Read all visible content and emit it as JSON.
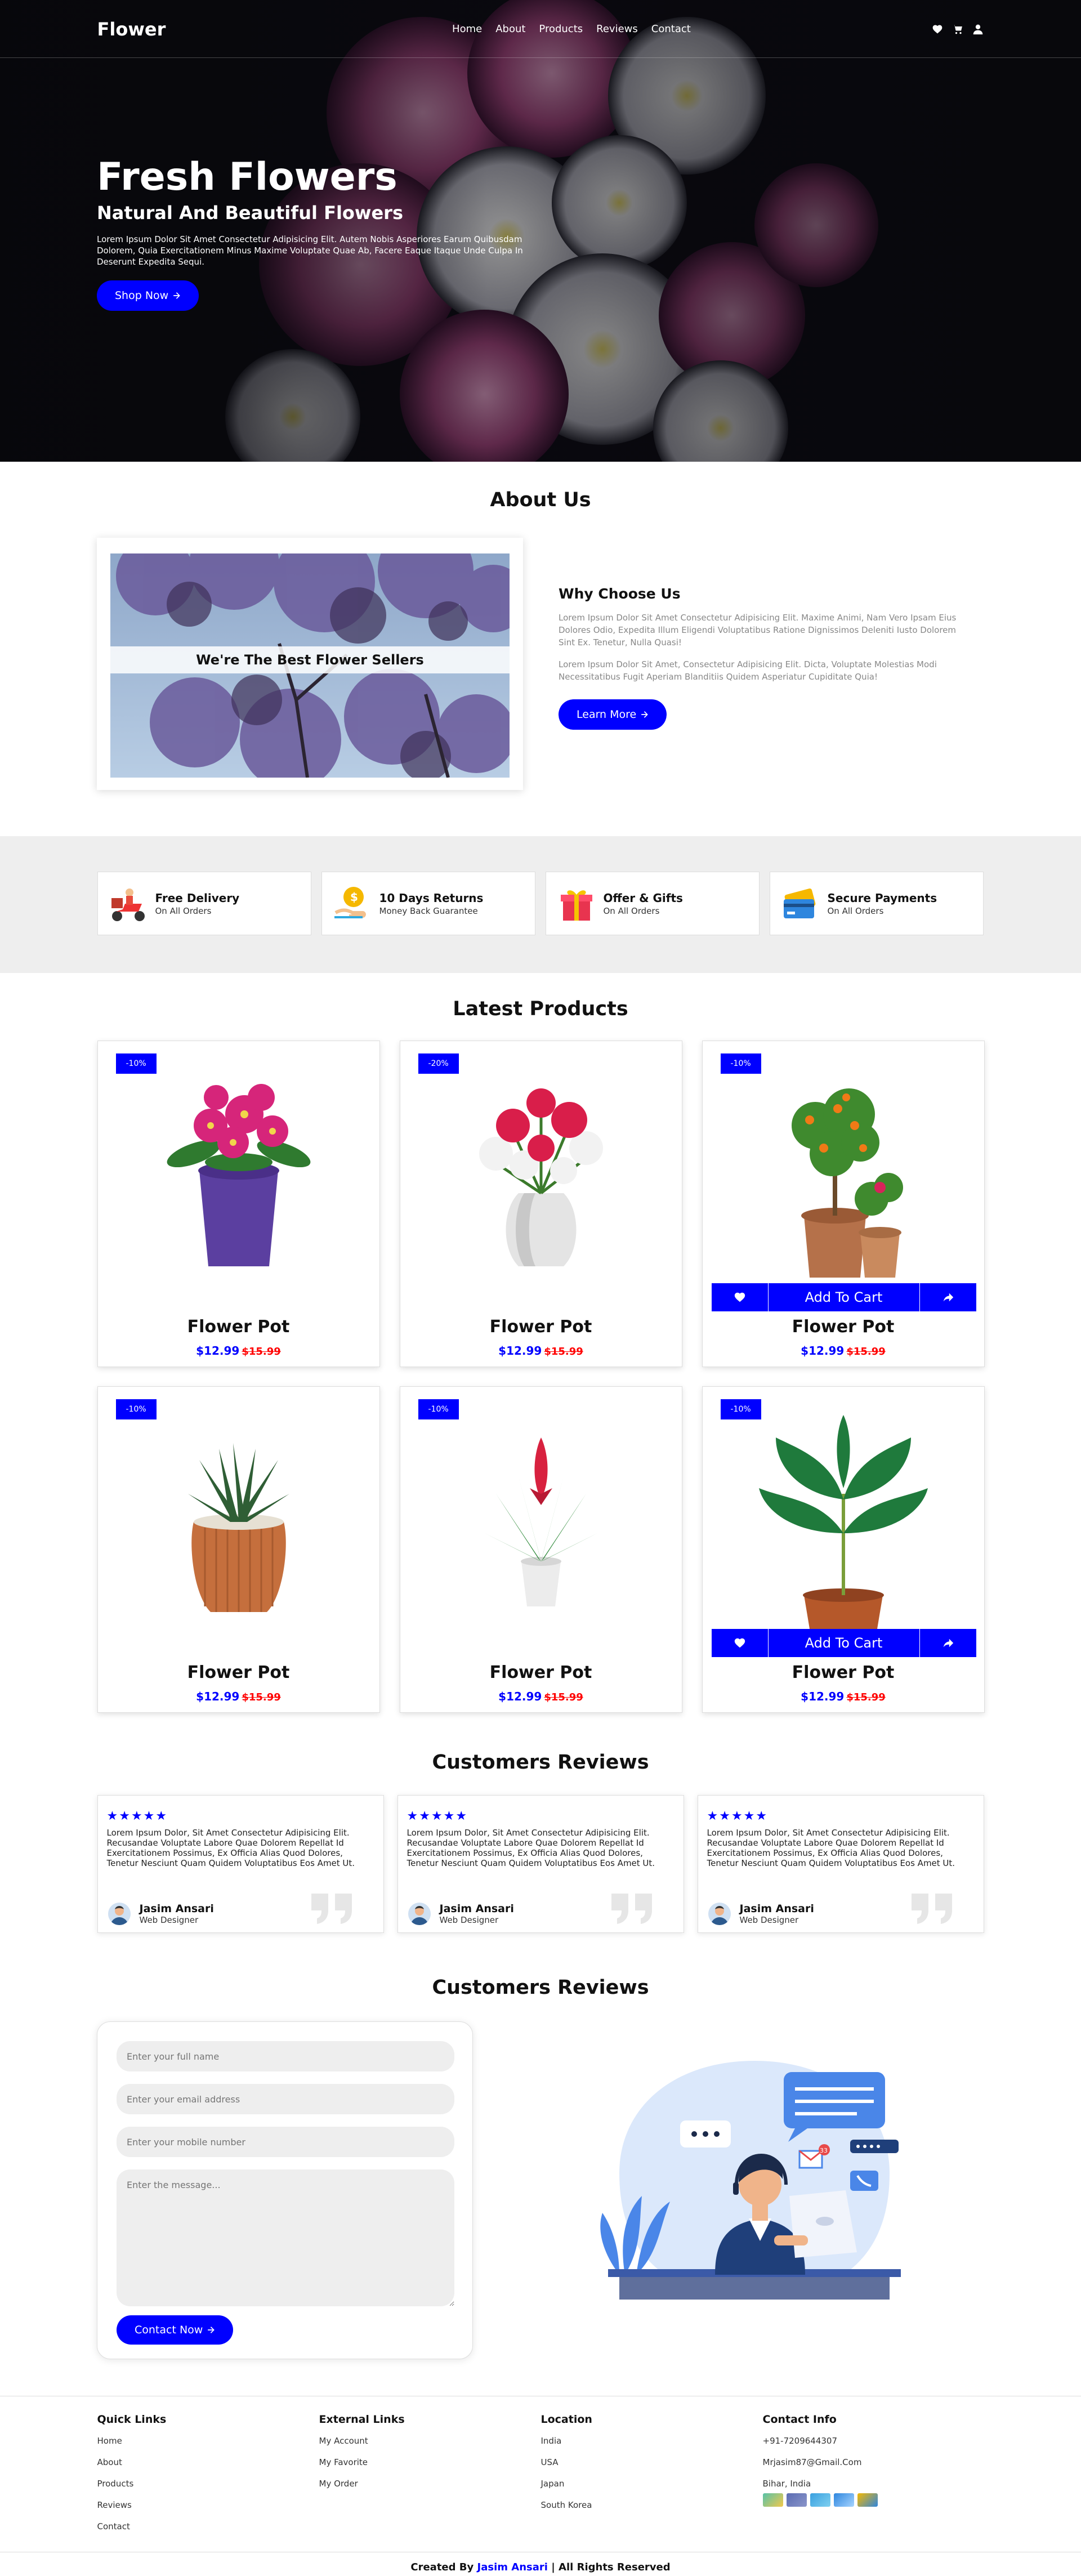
{
  "header": {
    "logo": "Flower",
    "nav": [
      "Home",
      "About",
      "Products",
      "Reviews",
      "Contact"
    ],
    "icons": [
      "heart-icon",
      "cart-icon",
      "user-icon"
    ]
  },
  "hero": {
    "title": "Fresh Flowers",
    "subtitle": "Natural And Beautiful Flowers",
    "text": "Lorem Ipsum Dolor Sit Amet Consectetur Adipisicing Elit. Autem Nobis Asperiores Earum Quibusdam Dolorem, Quia Exercitationem Minus Maxime Voluptate Quae Ab, Facere Eaque Itaque Unde Culpa In Deserunt Expedita Sequi.",
    "button": "Shop Now"
  },
  "about": {
    "title": "About Us",
    "caption": "We're The Best Flower Sellers",
    "heading": "Why Choose Us",
    "p1": "Lorem Ipsum Dolor Sit Amet Consectetur Adipisicing Elit. Maxime Animi, Nam Vero Ipsam Eius Dolores Odio, Expedita Illum Eligendi Voluptatibus Ratione Dignissimos Deleniti Iusto Dolorem Sint Ex. Tenetur, Nulla Quasi!",
    "p2": "Lorem Ipsum Dolor Sit Amet, Consectetur Adipisicing Elit. Dicta, Voluptate Molestias Modi Necessitatibus Fugit Aperiam Blanditiis Quidem Asperiatur Cupiditate Quia!",
    "button": "Learn More"
  },
  "features": [
    {
      "title": "Free Delivery",
      "sub": "On All Orders"
    },
    {
      "title": "10 Days Returns",
      "sub": "Money Back Guarantee"
    },
    {
      "title": "Offer & Gifts",
      "sub": "On All Orders"
    },
    {
      "title": "Secure Payments",
      "sub": "On All Orders"
    }
  ],
  "products": {
    "title": "Latest Products",
    "add_to_cart": "Add To Cart",
    "items": [
      {
        "badge": "-10%",
        "name": "Flower Pot",
        "price": "$12.99",
        "old": "$15.99"
      },
      {
        "badge": "-20%",
        "name": "Flower Pot",
        "price": "$12.99",
        "old": "$15.99"
      },
      {
        "badge": "-10%",
        "name": "Flower Pot",
        "price": "$12.99",
        "old": "$15.99"
      },
      {
        "badge": "-10%",
        "name": "Flower Pot",
        "price": "$12.99",
        "old": "$15.99"
      },
      {
        "badge": "-10%",
        "name": "Flower Pot",
        "price": "$12.99",
        "old": "$15.99"
      },
      {
        "badge": "-10%",
        "name": "Flower Pot",
        "price": "$12.99",
        "old": "$15.99"
      }
    ]
  },
  "reviews": {
    "title": "Customers Reviews",
    "stars": "★★★★★",
    "items": [
      {
        "text": "Lorem Ipsum Dolor, Sit Amet Consectetur Adipisicing Elit. Recusandae Voluptate Labore Quae Dolorem Repellat Id Exercitationem Possimus, Ex Officia Alias Quod Dolores, Tenetur Nesciunt Quam Quidem Voluptatibus Eos Amet Ut.",
        "name": "Jasim Ansari",
        "role": "Web Designer"
      },
      {
        "text": "Lorem Ipsum Dolor, Sit Amet Consectetur Adipisicing Elit. Recusandae Voluptate Labore Quae Dolorem Repellat Id Exercitationem Possimus, Ex Officia Alias Quod Dolores, Tenetur Nesciunt Quam Quidem Voluptatibus Eos Amet Ut.",
        "name": "Jasim Ansari",
        "role": "Web Designer"
      },
      {
        "text": "Lorem Ipsum Dolor, Sit Amet Consectetur Adipisicing Elit. Recusandae Voluptate Labore Quae Dolorem Repellat Id Exercitationem Possimus, Ex Officia Alias Quod Dolores, Tenetur Nesciunt Quam Quidem Voluptatibus Eos Amet Ut.",
        "name": "Jasim Ansari",
        "role": "Web Designer"
      }
    ]
  },
  "contact": {
    "title": "Customers Reviews",
    "name_placeholder": "Enter your full name",
    "email_placeholder": "Enter your email address",
    "mobile_placeholder": "Enter your mobile number",
    "message_placeholder": "Enter the message...",
    "button": "Contact Now",
    "illus_badge": "33"
  },
  "footer": {
    "quick": {
      "title": "Quick Links",
      "links": [
        "Home",
        "About",
        "Products",
        "Reviews",
        "Contact"
      ]
    },
    "external": {
      "title": "External Links",
      "links": [
        "My Account",
        "My Favorite",
        "My Order"
      ]
    },
    "location": {
      "title": "Location",
      "links": [
        "India",
        "USA",
        "Japan",
        "South Korea"
      ]
    },
    "contact": {
      "title": "Contact Info",
      "links": [
        "+91-7209644307",
        "Mrjasim87@Gmail.Com",
        "Bihar, India"
      ]
    },
    "copy_prefix": "Created By",
    "copy_author": "Jasim Ansari",
    "copy_suffix": "| All Rights Reserved"
  },
  "colors": {
    "accent": "#0000ff",
    "sale": "#ff0000",
    "feature_bg": "#eeeeee"
  }
}
